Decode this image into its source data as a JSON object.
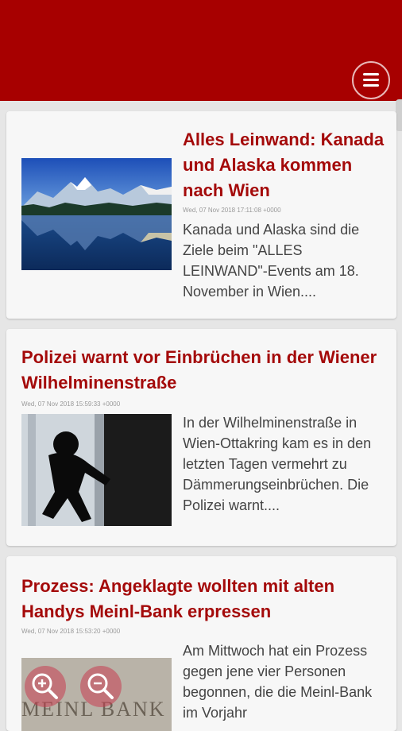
{
  "header": {
    "menu_icon": "hamburger-menu-icon"
  },
  "articles": [
    {
      "title": "Alles Leinwand: Kanada und Alaska kommen nach Wien",
      "date": "Wed, 07 Nov 2018 17:11:08 +0000",
      "teaser": "Kanada und Alaska sind die Ziele beim \"ALLES LEINWAND\"-Events am 18. November in Wien....",
      "image": "mountain-lake-image"
    },
    {
      "title": "Polizei warnt vor Einbrüchen in der Wiener Wilhelminenstraße",
      "date": "Wed, 07 Nov 2018 15:59:33 +0000",
      "teaser": "In der Wilhelminenstraße in Wien-Ottakring kam es in den letzten Tagen vermehrt zu Dämmerungseinbrüchen. Die Polizei warnt....",
      "image": "burglar-silhouette-image"
    },
    {
      "title": "Prozess: Angeklagte wollten mit alten Handys Meinl-Bank erpressen",
      "date": "Wed, 07 Nov 2018 15:53:20 +0000",
      "teaser": "Am Mittwoch hat ein Prozess gegen jene vier Personen begonnen, die die Meinl-Bank im Vorjahr",
      "image": "meinl-bank-sign-image",
      "image_text": "MEINL BANK"
    }
  ],
  "colors": {
    "header": "#a70000",
    "title": "#a40a0a",
    "background": "#e6e6e6",
    "card": "#f7f7f7"
  }
}
